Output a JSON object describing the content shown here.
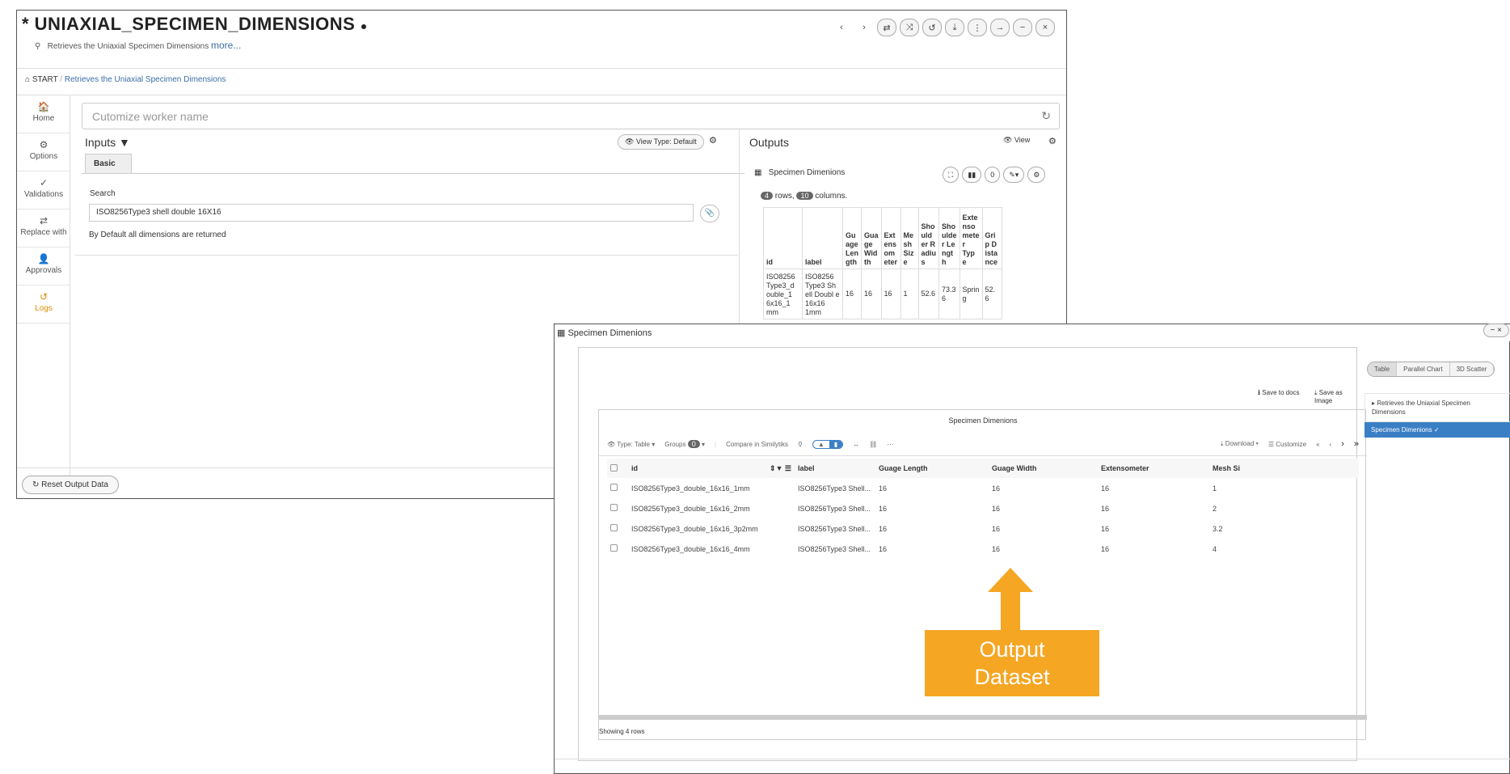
{
  "back_window": {
    "title": "* UNIAXIAL_SPECIMEN_DIMENSIONS",
    "info_icon": "info-icon",
    "subtitle": "Retrieves the Uniaxial Specimen Dimensions",
    "more_link": "more...",
    "toolbar_buttons": [
      "‹",
      "›",
      "⇄",
      "⤨",
      "↺",
      "⤓",
      "⋮",
      "→",
      "−",
      "×"
    ],
    "breadcrumb": {
      "home": "START",
      "separator": "/",
      "current": "Retrieves the Uniaxial Specimen Dimensions"
    },
    "sidebar": [
      {
        "icon": "home-icon",
        "glyph": "🏠",
        "label": "Home"
      },
      {
        "icon": "gear-icon",
        "glyph": "⚙",
        "label": "Options"
      },
      {
        "icon": "check-icon",
        "glyph": "✓",
        "label": "Validations"
      },
      {
        "icon": "swap-icon",
        "glyph": "⇄",
        "label": "Replace with"
      },
      {
        "icon": "user-check-icon",
        "glyph": "👤",
        "label": "Approvals"
      },
      {
        "icon": "history-icon",
        "glyph": "↺",
        "label": "Logs"
      }
    ],
    "worker_name_placeholder": "Cutomize worker name",
    "inputs": {
      "heading": "Inputs ▼",
      "view_type_button": "👁 View Type: Default",
      "tab_basic": "Basic",
      "search_label": "Search",
      "search_value": "ISO8256Type3 shell double 16X16",
      "default_note": "By Default all dimensions are returned"
    },
    "reset_button": "↻ Reset Output Data",
    "outputs": {
      "heading": "Outputs",
      "view_link": "👁 View",
      "dataset_title": "Specimen Dimenions",
      "rows_count": "4",
      "rows_text": "rows,",
      "cols_count": "10",
      "cols_text": "columns.",
      "mini_buttons": [
        "⛶",
        "▮▮",
        "0",
        "✎▾",
        "⚙"
      ],
      "table_headers": [
        "id",
        "label",
        "Gu age Len gth",
        "Gua ge Wid th",
        "Ext ens om eter",
        "Me sh Siz e",
        "Sho uld er R adiu s",
        "Sho ulde r Le ngt h",
        "Exte nso mete r Typ e",
        "Gri p D ista nce"
      ],
      "table_row": [
        "ISO8256 Type3_d ouble_1 6x16_1 mm",
        "ISO8256 Type3 Sh ell Doubl e 16x16 1mm",
        "16",
        "16",
        "16",
        "1",
        "52.6",
        "73.3 6",
        "Sprin g",
        "52. 6"
      ]
    }
  },
  "front_dialog": {
    "title": "Specimen Dimenions",
    "close_buttons": "−  ×",
    "save_docs": "Save to docs",
    "save_image": "Save as Image",
    "view_tabs": [
      "Table",
      "Parallel Chart",
      "3D Scatter"
    ],
    "right_panel": {
      "item1": "▸ Retrieves the Uniaxial Specimen Dimensions",
      "item2": "Specimen Dimenions ✓"
    },
    "table_title": "Specimen Dimenions",
    "toolbar": {
      "type": "Type: Table ▾",
      "groups": "Groups",
      "groups_count": "0",
      "compare": "Compare in Similytiks",
      "download": "Download ▾",
      "customize": "Customize",
      "pager": [
        "«",
        "‹",
        "›",
        "»"
      ]
    },
    "columns": [
      "id",
      "label",
      "Guage Length",
      "Guage Width",
      "Extensometer",
      "Mesh Si"
    ],
    "rows": [
      [
        "ISO8256Type3_double_16x16_1mm",
        "ISO8256Type3 Shell...",
        "16",
        "16",
        "16",
        "1"
      ],
      [
        "ISO8256Type3_double_16x16_2mm",
        "ISO8256Type3 Shell...",
        "16",
        "16",
        "16",
        "2"
      ],
      [
        "ISO8256Type3_double_16x16_3p2mm",
        "ISO8256Type3 Shell...",
        "16",
        "16",
        "16",
        "3.2"
      ],
      [
        "ISO8256Type3_double_16x16_4mm",
        "ISO8256Type3 Shell...",
        "16",
        "16",
        "16",
        "4"
      ]
    ],
    "footer": "Showing 4 rows"
  },
  "annotation": {
    "line1": "Output",
    "line2": "Dataset",
    "color": "#f5a623"
  }
}
